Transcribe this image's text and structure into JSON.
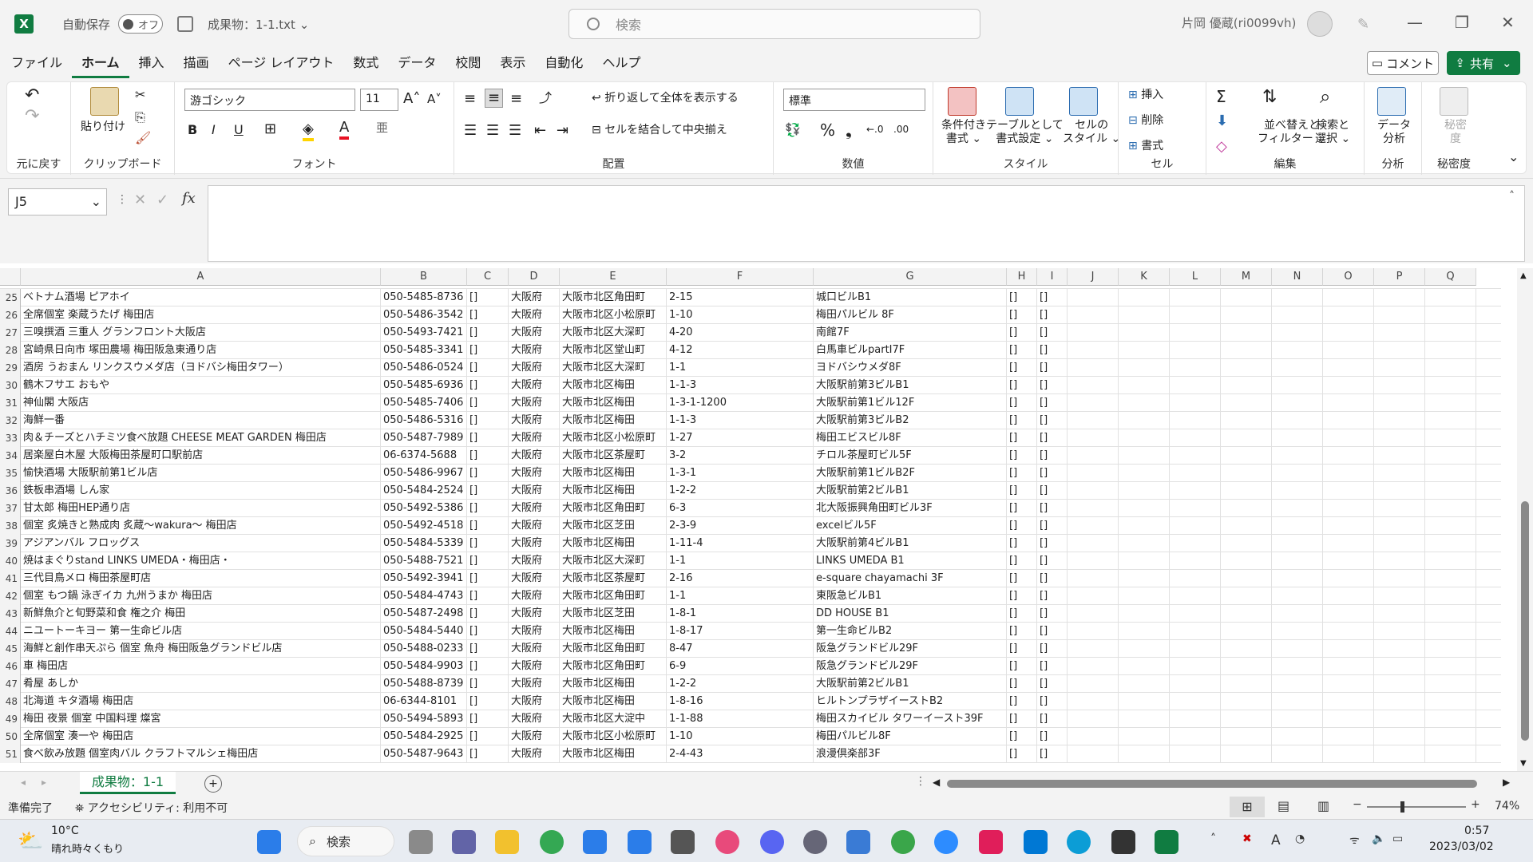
{
  "title": {
    "autosave": "自動保存",
    "toggle": "オフ",
    "doc": "成果物：1-1.txt ⌄",
    "search": "検索",
    "user": "片岡 優蔵(ri0099vh)"
  },
  "menu": [
    "ファイル",
    "ホーム",
    "挿入",
    "描画",
    "ページ レイアウト",
    "数式",
    "データ",
    "校閲",
    "表示",
    "自動化",
    "ヘルプ"
  ],
  "buttons": {
    "comment": "コメント",
    "share": "共有"
  },
  "ribbon": {
    "undo_label": "元に戻す",
    "clipboard_label": "クリップボード",
    "paste": "貼り付け",
    "font_label": "フォント",
    "font_name": "游ゴシック",
    "font_size": "11",
    "align_label": "配置",
    "wrap": "折り返して全体を表示する",
    "merge": "セルを結合して中央揃え",
    "number_label": "数値",
    "number_format": "標準",
    "style_label": "スタイル",
    "cond_format": "条件付き\n書式 ⌄",
    "table_format": "テーブルとして\n書式設定 ⌄",
    "cell_style": "セルの\nスタイル ⌄",
    "cells_label": "セル",
    "insert": "挿入",
    "delete": "削除",
    "format": "書式",
    "edit_label": "編集",
    "sort": "並べ替えと\nフィルター ⌄",
    "find": "検索と\n選択 ⌄",
    "analysis_label": "分析",
    "data_analysis": "データ\n分析",
    "sensitivity_label": "秘密度",
    "sensitivity": "秘密\n度"
  },
  "namebox": "J5",
  "columns": [
    "A",
    "B",
    "C",
    "D",
    "E",
    "F",
    "G",
    "H",
    "I",
    "J",
    "K",
    "L",
    "M",
    "N",
    "O",
    "P",
    "Q"
  ],
  "rows": [
    {
      "n": "25",
      "a": "ベトナム酒場 ピアホイ",
      "b": "050-5485-8736",
      "d": "大阪府",
      "e": "大阪市北区角田町",
      "f": "2-15",
      "g": "城口ビルB1"
    },
    {
      "n": "26",
      "a": "全席個室 楽蔵うたげ 梅田店",
      "b": "050-5486-3542",
      "d": "大阪府",
      "e": "大阪市北区小松原町",
      "f": "1-10",
      "g": "梅田パルビル 8F"
    },
    {
      "n": "27",
      "a": "三嗅撰酒 三重人 グランフロント大阪店",
      "b": "050-5493-7421",
      "d": "大阪府",
      "e": "大阪市北区大深町",
      "f": "4-20",
      "g": "南館7F"
    },
    {
      "n": "28",
      "a": "宮崎県日向市 塚田農場 梅田阪急東通り店",
      "b": "050-5485-3341",
      "d": "大阪府",
      "e": "大阪市北区堂山町",
      "f": "4-12",
      "g": "白馬車ビルpartⅠ7F"
    },
    {
      "n": "29",
      "a": "酒房 うおまん リンクスウメダ店（ヨドバシ梅田タワー）",
      "b": "050-5486-0524",
      "d": "大阪府",
      "e": "大阪市北区大深町",
      "f": "1-1",
      "g": "ヨドバシウメダ8F"
    },
    {
      "n": "30",
      "a": "鶴木フサエ おもや",
      "b": "050-5485-6936",
      "d": "大阪府",
      "e": "大阪市北区梅田",
      "f": "1-1-3",
      "g": "大阪駅前第3ビルB1"
    },
    {
      "n": "31",
      "a": "神仙閣 大阪店",
      "b": "050-5485-7406",
      "d": "大阪府",
      "e": "大阪市北区梅田",
      "f": "1-3-1-1200",
      "g": "大阪駅前第1ビル12F"
    },
    {
      "n": "32",
      "a": "海鮮一番",
      "b": "050-5486-5316",
      "d": "大阪府",
      "e": "大阪市北区梅田",
      "f": "1-1-3",
      "g": "大阪駅前第3ビルB2"
    },
    {
      "n": "33",
      "a": "肉＆チーズとハチミツ食べ放題 CHEESE MEAT GARDEN 梅田店",
      "b": "050-5487-7989",
      "d": "大阪府",
      "e": "大阪市北区小松原町",
      "f": "1-27",
      "g": "梅田エビスビル8F"
    },
    {
      "n": "34",
      "a": "居楽屋白木屋 大阪梅田茶屋町口駅前店",
      "b": "06-6374-5688",
      "d": "大阪府",
      "e": "大阪市北区茶屋町",
      "f": "3-2",
      "g": "チロル茶屋町ビル5F"
    },
    {
      "n": "35",
      "a": "愉快酒場 大阪駅前第1ビル店",
      "b": "050-5486-9967",
      "d": "大阪府",
      "e": "大阪市北区梅田",
      "f": "1-3-1",
      "g": "大阪駅前第1ビルB2F"
    },
    {
      "n": "36",
      "a": "鉄板串酒場 しん家",
      "b": "050-5484-2524",
      "d": "大阪府",
      "e": "大阪市北区梅田",
      "f": "1-2-2",
      "g": "大阪駅前第2ビルB1"
    },
    {
      "n": "37",
      "a": "甘太郎 梅田HEP通り店",
      "b": "050-5492-5386",
      "d": "大阪府",
      "e": "大阪市北区角田町",
      "f": "6-3",
      "g": "北大阪振興角田町ビル3F"
    },
    {
      "n": "38",
      "a": "個室 炙焼きと熟成肉 炙蔵〜wakura〜 梅田店",
      "b": "050-5492-4518",
      "d": "大阪府",
      "e": "大阪市北区芝田",
      "f": "2-3-9",
      "g": "excelビル5F"
    },
    {
      "n": "39",
      "a": "アジアンバル フロッグス",
      "b": "050-5484-5339",
      "d": "大阪府",
      "e": "大阪市北区梅田",
      "f": "1-11-4",
      "g": "大阪駅前第4ビルB1"
    },
    {
      "n": "40",
      "a": "焼はまぐりstand LINKS UMEDA・梅田店・",
      "b": "050-5488-7521",
      "d": "大阪府",
      "e": "大阪市北区大深町",
      "f": "1-1",
      "g": "LINKS UMEDA B1"
    },
    {
      "n": "41",
      "a": "三代目鳥メロ 梅田茶屋町店",
      "b": "050-5492-3941",
      "d": "大阪府",
      "e": "大阪市北区茶屋町",
      "f": "2-16",
      "g": "e-square chayamachi 3F"
    },
    {
      "n": "42",
      "a": "個室 もつ鍋 泳ぎイカ 九州うまか 梅田店",
      "b": "050-5484-4743",
      "d": "大阪府",
      "e": "大阪市北区角田町",
      "f": "1-1",
      "g": "東阪急ビルB1"
    },
    {
      "n": "43",
      "a": "新鮮魚介と旬野菜和食 権之介 梅田",
      "b": "050-5487-2498",
      "d": "大阪府",
      "e": "大阪市北区芝田",
      "f": "1-8-1",
      "g": "DD HOUSE B1"
    },
    {
      "n": "44",
      "a": "ニユートーキヨー 第一生命ビル店",
      "b": "050-5484-5440",
      "d": "大阪府",
      "e": "大阪市北区梅田",
      "f": "1-8-17",
      "g": "第一生命ビルB2"
    },
    {
      "n": "45",
      "a": "海鮮と創作串天ぷら 個室 魚舟 梅田阪急グランドビル店",
      "b": "050-5488-0233",
      "d": "大阪府",
      "e": "大阪市北区角田町",
      "f": "8-47",
      "g": "阪急グランドビル29F"
    },
    {
      "n": "46",
      "a": "車 梅田店",
      "b": "050-5484-9903",
      "d": "大阪府",
      "e": "大阪市北区角田町",
      "f": "6-9",
      "g": "阪急グランドビル29F"
    },
    {
      "n": "47",
      "a": "肴屋 あしか",
      "b": "050-5488-8739",
      "d": "大阪府",
      "e": "大阪市北区梅田",
      "f": "1-2-2",
      "g": "大阪駅前第2ビルB1"
    },
    {
      "n": "48",
      "a": "北海道 キタ酒場 梅田店",
      "b": "06-6344-8101",
      "d": "大阪府",
      "e": "大阪市北区梅田",
      "f": "1-8-16",
      "g": "ヒルトンプラザイーストB2"
    },
    {
      "n": "49",
      "a": "梅田 夜景 個室 中国料理 燦宮",
      "b": "050-5494-5893",
      "d": "大阪府",
      "e": "大阪市北区大淀中",
      "f": "1-1-88",
      "g": "梅田スカイビル タワーイースト39F"
    },
    {
      "n": "50",
      "a": "全席個室 湊一や 梅田店",
      "b": "050-5484-2925",
      "d": "大阪府",
      "e": "大阪市北区小松原町",
      "f": "1-10",
      "g": "梅田パルビル8F"
    },
    {
      "n": "51",
      "a": "食べ飲み放題 個室肉バル クラフトマルシェ梅田店",
      "b": "050-5487-9643",
      "d": "大阪府",
      "e": "大阪市北区梅田",
      "f": "2-4-43",
      "g": "浪漫倶楽部3F"
    }
  ],
  "bracket": "[]",
  "sheet_tab": "成果物：1-1",
  "status": {
    "ready": "準備完了",
    "accessibility": "アクセシビリティ: 利用不可",
    "zoom": "74%"
  },
  "taskbar": {
    "temp": "10°C",
    "weather": "晴れ時々くもり",
    "search": "検索",
    "time": "0:57",
    "date": "2023/03/02"
  }
}
